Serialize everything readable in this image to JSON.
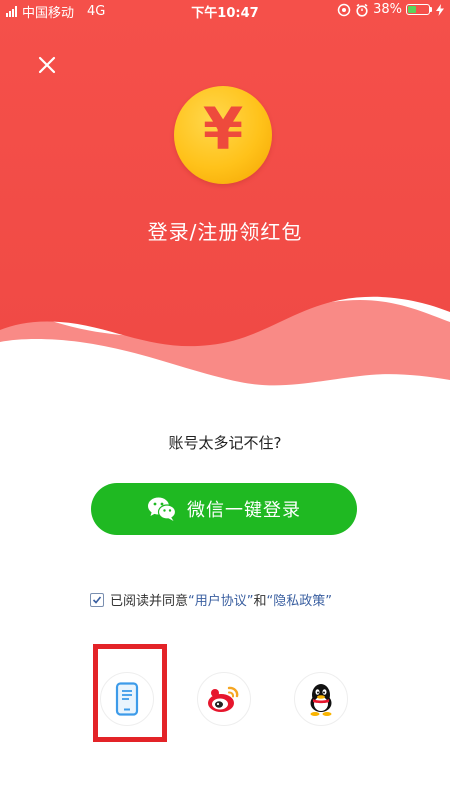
{
  "status_bar": {
    "carrier": "中国移动",
    "network": "4G",
    "time": "下午10:47",
    "battery": "38%",
    "battery_level": 0.38
  },
  "header": {
    "close_icon": "close-icon",
    "coin_symbol": "¥",
    "title": "登录/注册领红包",
    "colors": {
      "background": "#f24c47",
      "wave_light": "#f98a86",
      "coin": "#ffc21a",
      "coin_symbol": "#ee4a3c"
    }
  },
  "main": {
    "hint": "账号太多记不住?",
    "wechat_button": {
      "icon": "wechat-icon",
      "label": "微信一键登录",
      "color": "#1fb922"
    },
    "agreement": {
      "checked": true,
      "prefix": "已阅读并同意",
      "user_agreement": "“用户协议”",
      "and": "和",
      "privacy_policy": "“隐私政策”"
    },
    "social_logins": [
      {
        "name": "phone",
        "icon": "phone-icon",
        "color": "#3d9be9"
      },
      {
        "name": "weibo",
        "icon": "weibo-icon",
        "color": "#e6162d"
      },
      {
        "name": "qq",
        "icon": "qq-penguin-icon",
        "color": "#000000"
      }
    ],
    "highlight": {
      "target": "phone",
      "color": "#e32328"
    }
  }
}
